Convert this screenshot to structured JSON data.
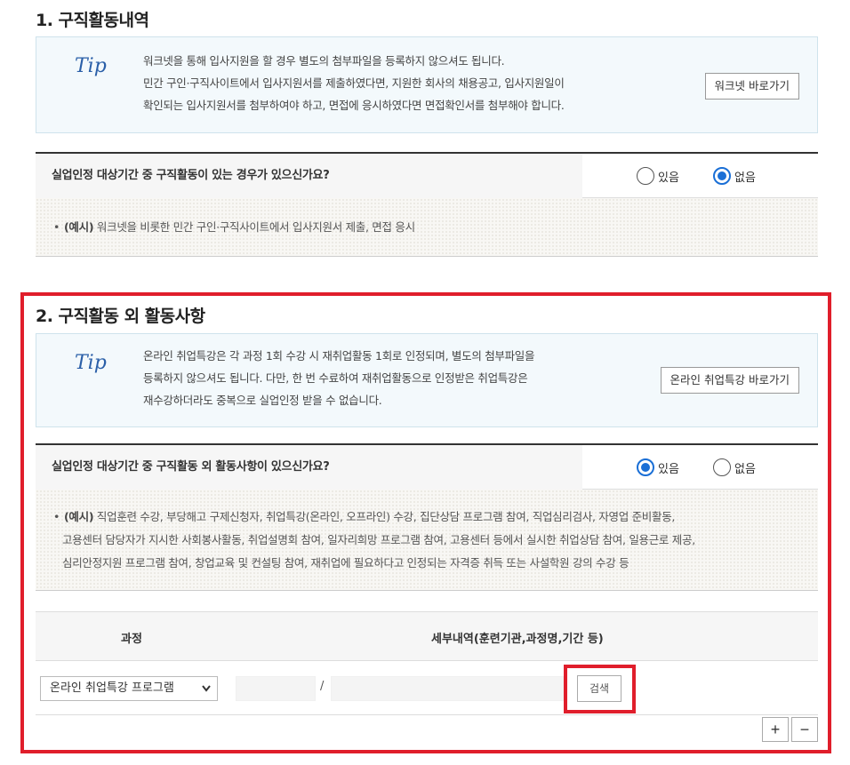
{
  "section1": {
    "title": "1. 구직활동내역",
    "tip": {
      "mark": "Tip",
      "lines": [
        "워크넷을 통해 입사지원을 할 경우 별도의 첨부파일을 등록하지 않으셔도 됩니다.",
        "민간 구인·구직사이트에서 입사지원서를 제출하였다면, 지원한 회사의 채용공고, 입사지원일이",
        "확인되는 입사지원서를 첨부하여야 하고, 면접에 응시하였다면 면접확인서를 첨부해야 합니다."
      ],
      "button": "워크넷 바로가기"
    },
    "question": "실업인정 대상기간 중 구직활동이 있는 경우가 있으신가요?",
    "options": [
      "있음",
      "없음"
    ],
    "example": {
      "bullet": "•",
      "label": "(예시)",
      "text": "워크넷을 비롯한 민간 구인·구직사이트에서 입사지원서 제출, 면접 응시"
    }
  },
  "section2": {
    "title": "2. 구직활동 외 활동사항",
    "tip": {
      "mark": "Tip",
      "lines": [
        "온라인 취업특강은 각 과정 1회 수강 시 재취업활동 1회로 인정되며, 별도의 첨부파일을",
        "등록하지 않으셔도 됩니다. 다만, 한 번 수료하여 재취업활동으로 인정받은 취업특강은",
        "재수강하더라도 중복으로 실업인정 받을 수 없습니다."
      ],
      "button": "온라인 취업특강 바로가기"
    },
    "question": "실업인정 대상기간 중 구직활동 외 활동사항이 있으신가요?",
    "options": [
      "있음",
      "없음"
    ],
    "example": {
      "bullet": "•",
      "label": "(예시)",
      "line1": "직업훈련 수강, 부당해고 구제신청자, 취업특강(온라인, 오프라인) 수강, 집단상담 프로그램 참여, 직업심리검사, 자영업 준비활동,",
      "line2": "고용센터 담당자가 지시한 사회봉사활동, 취업설명회 참여, 일자리희망 프로그램 참여, 고용센터 등에서 실시한 취업상담 참여, 일용근로 제공,",
      "line3": "심리안정지원 프로그램 참여, 창업교육 및 컨설팅 참여, 재취업에 필요하다고 인정되는 자격증 취득 또는 사설학원 강의 수강 등"
    },
    "table": {
      "col1": "과정",
      "col2": "세부내역(훈련기관,과정명,기간 등)",
      "row": {
        "select_value": "온라인 취업특강 프로그램",
        "separator": "/",
        "search_button": "검색"
      },
      "add_button": "+",
      "remove_button": "−"
    }
  },
  "colors": {
    "accent": "#1a6fd6",
    "highlight": "#e01e2b"
  }
}
